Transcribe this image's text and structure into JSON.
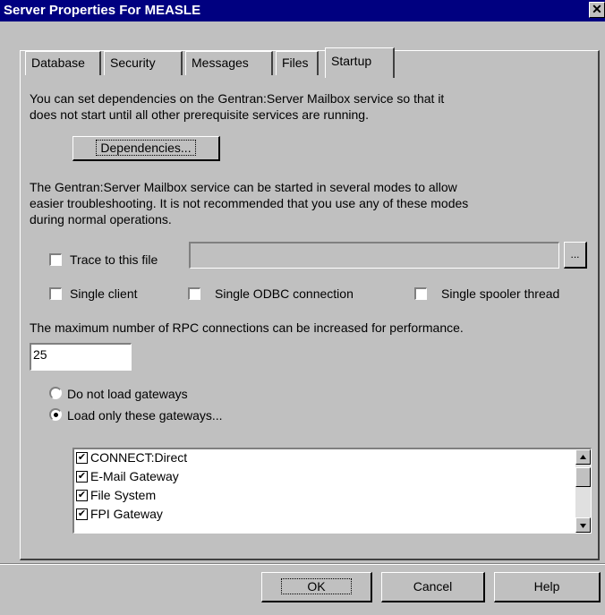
{
  "window": {
    "title": "Server Properties For MEASLE",
    "close_glyph": "✕"
  },
  "tabs": [
    {
      "label": "Database"
    },
    {
      "label": "Security"
    },
    {
      "label": "Messages"
    },
    {
      "label": "Files"
    },
    {
      "label": "Startup",
      "active": true
    }
  ],
  "startup": {
    "dependencies_text_1": "You can set dependencies on the Gentran:Server Mailbox service so that it",
    "dependencies_text_2": "does not start until all other prerequisite services are running.",
    "dependencies_button": "Dependencies...",
    "modes_text_1": "The Gentran:Server Mailbox service can be started in several modes to allow",
    "modes_text_2": "easier troubleshooting. It is not recommended that you use any of these modes",
    "modes_text_3": "during normal operations.",
    "trace_label": "Trace to this file",
    "trace_value": "",
    "browse_button": "...",
    "single_client": "Single client",
    "single_odbc": "Single ODBC connection",
    "single_spooler": "Single spooler thread",
    "rpc_text": "The maximum number of RPC connections can be increased for performance.",
    "rpc_value": "25",
    "radio_no_gateways": "Do not load gateways",
    "radio_load_gateways": "Load only these gateways...",
    "selected_radio": "load_only",
    "gateways": [
      {
        "label": "CONNECT:Direct",
        "checked": true
      },
      {
        "label": "E-Mail Gateway",
        "checked": true
      },
      {
        "label": "File System",
        "checked": true
      },
      {
        "label": "FPI Gateway",
        "checked": true
      }
    ]
  },
  "footer": {
    "ok": "OK",
    "cancel": "Cancel",
    "help": "Help"
  }
}
